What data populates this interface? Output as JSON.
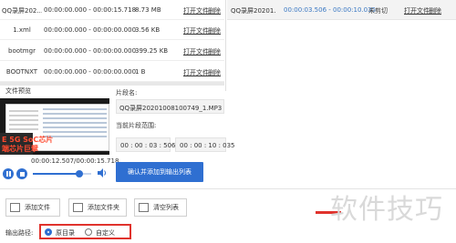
{
  "files": [
    {
      "name": "QQ录屏202...",
      "range": "00:00:00.000 - 00:00:15.718",
      "size": "8.73 MB",
      "open": "打开文件",
      "del": "删除"
    },
    {
      "name": "1.xml",
      "range": "00:00:00.000 - 00:00:00.000",
      "size": "3.56 KB",
      "open": "打开文件",
      "del": "删除"
    },
    {
      "name": "bootmgr",
      "range": "00:00:00.000 - 00:00:00.000",
      "size": "399.25 KB",
      "open": "打开文件",
      "del": "删除"
    },
    {
      "name": "BOOTNXT",
      "range": "00:00:00.000 - 00:00:00.000",
      "size": "1 B",
      "open": "打开文件",
      "del": "删除"
    }
  ],
  "tasks": [
    {
      "name": "QQ录屏20201...",
      "range": "00:00:03.506 - 00:00:10.035",
      "status": "未剪切",
      "open": "打开文件",
      "del": "删除"
    }
  ],
  "preview": {
    "label": "文件预览",
    "slide_text_1": "E 5G SoC芯片",
    "slide_text_2": "端芯片巨擘",
    "time": "00:00:12.507/00:00:15.718",
    "progress_fraction": 0.8
  },
  "clip": {
    "name_label": "片段名:",
    "name_value": "QQ录屏20201008100749_1.MP3",
    "range_label": "当前片段范围:",
    "start": "00 : 00 : 03 : 506",
    "end": "00 : 00 : 10 : 035",
    "confirm_button": "确认并添加到输出列表"
  },
  "actions": {
    "add_file": "添加文件",
    "add_folder": "添加文件夹",
    "clear_list": "清空列表"
  },
  "output": {
    "label": "输出路径:",
    "original_dir": "原目录",
    "custom": "自定义",
    "selected": "原目录"
  },
  "watermark": "软件技巧",
  "colors": {
    "accent": "#2f6fd1",
    "highlight_border": "#e0322c",
    "task_row_bg": "#f3f3f3"
  }
}
